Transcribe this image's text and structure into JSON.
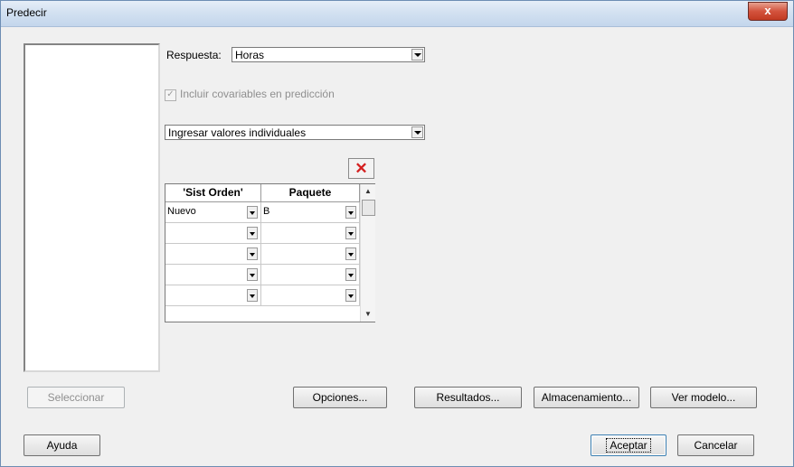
{
  "window": {
    "title": "Predecir",
    "close_label": "x"
  },
  "respuesta": {
    "label": "Respuesta:",
    "value": "Horas"
  },
  "covariables": {
    "label": "Incluir covariables en predicción",
    "checked": true,
    "enabled": false
  },
  "modo": {
    "value": "Ingresar valores individuales"
  },
  "grid": {
    "headers": [
      "'Sist Orden'",
      "Paquete"
    ],
    "rows": [
      [
        "Nuevo",
        "B"
      ],
      [
        "",
        ""
      ],
      [
        "",
        ""
      ],
      [
        "",
        ""
      ],
      [
        "",
        ""
      ]
    ]
  },
  "buttons": {
    "seleccionar": "Seleccionar",
    "opciones": "Opciones...",
    "resultados": "Resultados...",
    "almacenamiento": "Almacenamiento...",
    "ver_modelo": "Ver modelo...",
    "ayuda": "Ayuda",
    "aceptar": "Aceptar",
    "cancelar": "Cancelar"
  },
  "icons": {
    "delete": "delete-row-icon",
    "close": "close-icon"
  },
  "colors": {
    "delete_icon": "#d42020",
    "titlebar": "#d3e1f1",
    "close_button": "#c23a22"
  }
}
